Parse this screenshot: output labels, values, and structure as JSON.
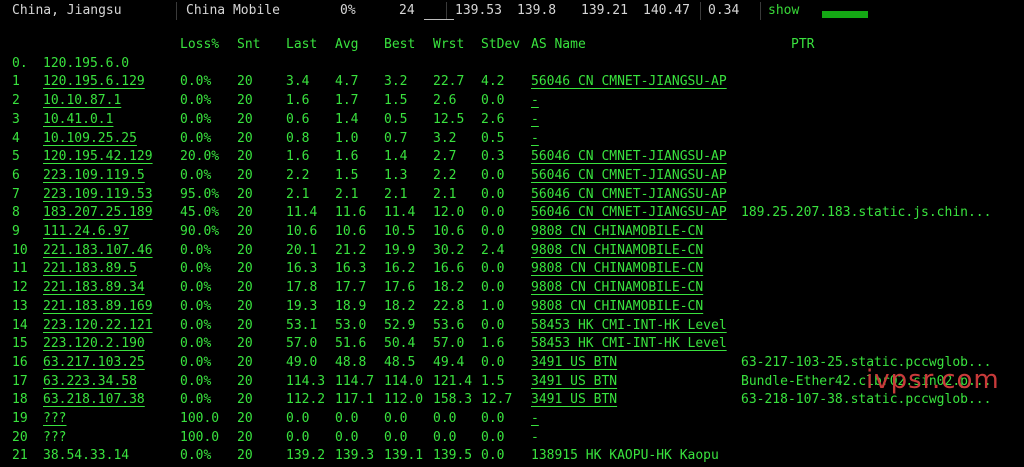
{
  "header": {
    "location": "China, Jiangsu",
    "isp": "China Mobile",
    "loss": "0%",
    "sent": "24",
    "last": "139.53",
    "avg": "139.8",
    "best": "139.21",
    "worst": "140.47",
    "stdev": "0.34",
    "show_label": "show"
  },
  "columns": {
    "loss": "Loss%",
    "snt": "Snt",
    "last": "Last",
    "avg": "Avg",
    "best": "Best",
    "wrst": "Wrst",
    "stdev": "StDev",
    "as": "AS Name",
    "ptr": "PTR"
  },
  "hops": [
    {
      "n": "0.",
      "ip": "120.195.6.0",
      "loss": "",
      "snt": "",
      "last": "",
      "avg": "",
      "best": "",
      "wrst": "",
      "stdev": "",
      "as": "",
      "ptr": "",
      "ul": false
    },
    {
      "n": "1",
      "ip": "120.195.6.129",
      "loss": "0.0%",
      "snt": "20",
      "last": "3.4",
      "avg": "4.7",
      "best": "3.2",
      "wrst": "22.7",
      "stdev": "4.2",
      "as": "56046 CN CMNET-JIANGSU-AP",
      "ptr": "",
      "ul": true
    },
    {
      "n": "2",
      "ip": "10.10.87.1",
      "loss": "0.0%",
      "snt": "20",
      "last": "1.6",
      "avg": "1.7",
      "best": "1.5",
      "wrst": "2.6",
      "stdev": "0.0",
      "as": "-",
      "ptr": "",
      "ul": true
    },
    {
      "n": "3",
      "ip": "10.41.0.1",
      "loss": "0.0%",
      "snt": "20",
      "last": "0.6",
      "avg": "1.4",
      "best": "0.5",
      "wrst": "12.5",
      "stdev": "2.6",
      "as": "-",
      "ptr": "",
      "ul": true
    },
    {
      "n": "4",
      "ip": "10.109.25.25",
      "loss": "0.0%",
      "snt": "20",
      "last": "0.8",
      "avg": "1.0",
      "best": "0.7",
      "wrst": "3.2",
      "stdev": "0.5",
      "as": "-",
      "ptr": "",
      "ul": true
    },
    {
      "n": "5",
      "ip": "120.195.42.129",
      "loss": "20.0%",
      "snt": "20",
      "last": "1.6",
      "avg": "1.6",
      "best": "1.4",
      "wrst": "2.7",
      "stdev": "0.3",
      "as": "56046 CN CMNET-JIANGSU-AP",
      "ptr": "",
      "ul": true
    },
    {
      "n": "6",
      "ip": "223.109.119.5",
      "loss": "0.0%",
      "snt": "20",
      "last": "2.2",
      "avg": "1.5",
      "best": "1.3",
      "wrst": "2.2",
      "stdev": "0.0",
      "as": "56046 CN CMNET-JIANGSU-AP",
      "ptr": "",
      "ul": true
    },
    {
      "n": "7",
      "ip": "223.109.119.53",
      "loss": "95.0%",
      "snt": "20",
      "last": "2.1",
      "avg": "2.1",
      "best": "2.1",
      "wrst": "2.1",
      "stdev": "0.0",
      "as": "56046 CN CMNET-JIANGSU-AP",
      "ptr": "",
      "ul": true
    },
    {
      "n": "8",
      "ip": "183.207.25.189",
      "loss": "45.0%",
      "snt": "20",
      "last": "11.4",
      "avg": "11.6",
      "best": "11.4",
      "wrst": "12.0",
      "stdev": "0.0",
      "as": "56046 CN CMNET-JIANGSU-AP",
      "ptr": "189.25.207.183.static.js.chin...",
      "ul": true
    },
    {
      "n": "9",
      "ip": "111.24.6.97",
      "loss": "90.0%",
      "snt": "20",
      "last": "10.6",
      "avg": "10.6",
      "best": "10.5",
      "wrst": "10.6",
      "stdev": "0.0",
      "as": "9808  CN CHINAMOBILE-CN",
      "ptr": "",
      "ul": true
    },
    {
      "n": "10",
      "ip": "221.183.107.46",
      "loss": "0.0%",
      "snt": "20",
      "last": "20.1",
      "avg": "21.2",
      "best": "19.9",
      "wrst": "30.2",
      "stdev": "2.4",
      "as": "9808  CN CHINAMOBILE-CN",
      "ptr": "",
      "ul": true
    },
    {
      "n": "11",
      "ip": "221.183.89.5",
      "loss": "0.0%",
      "snt": "20",
      "last": "16.3",
      "avg": "16.3",
      "best": "16.2",
      "wrst": "16.6",
      "stdev": "0.0",
      "as": "9808  CN CHINAMOBILE-CN",
      "ptr": "",
      "ul": true
    },
    {
      "n": "12",
      "ip": "221.183.89.34",
      "loss": "0.0%",
      "snt": "20",
      "last": "17.8",
      "avg": "17.7",
      "best": "17.6",
      "wrst": "18.2",
      "stdev": "0.0",
      "as": "9808  CN CHINAMOBILE-CN",
      "ptr": "",
      "ul": true
    },
    {
      "n": "13",
      "ip": "221.183.89.169",
      "loss": "0.0%",
      "snt": "20",
      "last": "19.3",
      "avg": "18.9",
      "best": "18.2",
      "wrst": "22.8",
      "stdev": "1.0",
      "as": "9808  CN CHINAMOBILE-CN",
      "ptr": "",
      "ul": true
    },
    {
      "n": "14",
      "ip": "223.120.22.121",
      "loss": "0.0%",
      "snt": "20",
      "last": "53.1",
      "avg": "53.0",
      "best": "52.9",
      "wrst": "53.6",
      "stdev": "0.0",
      "as": "58453 HK CMI-INT-HK Level",
      "ptr": "",
      "ul": true
    },
    {
      "n": "15",
      "ip": "223.120.2.190",
      "loss": "0.0%",
      "snt": "20",
      "last": "57.0",
      "avg": "51.6",
      "best": "50.4",
      "wrst": "57.0",
      "stdev": "1.6",
      "as": "58453 HK CMI-INT-HK Level",
      "ptr": "",
      "ul": true
    },
    {
      "n": "16",
      "ip": "63.217.103.25",
      "loss": "0.0%",
      "snt": "20",
      "last": "49.0",
      "avg": "48.8",
      "best": "48.5",
      "wrst": "49.4",
      "stdev": "0.0",
      "as": "3491  US BTN",
      "ptr": "63-217-103-25.static.pccwglob...",
      "ul": true
    },
    {
      "n": "17",
      "ip": "63.223.34.58",
      "loss": "0.0%",
      "snt": "20",
      "last": "114.3",
      "avg": "114.7",
      "best": "114.0",
      "wrst": "121.4",
      "stdev": "1.5",
      "as": "3491  US BTN",
      "ptr": "Bundle-Ether42.clbr02.sin02.p...",
      "ul": true
    },
    {
      "n": "18",
      "ip": "63.218.107.38",
      "loss": "0.0%",
      "snt": "20",
      "last": "112.2",
      "avg": "117.1",
      "best": "112.0",
      "wrst": "158.3",
      "stdev": "12.7",
      "as": "3491  US BTN",
      "ptr": "63-218-107-38.static.pccwglob...",
      "ul": true
    },
    {
      "n": "19",
      "ip": "???",
      "loss": "100.0",
      "snt": "20",
      "last": "0.0",
      "avg": "0.0",
      "best": "0.0",
      "wrst": "0.0",
      "stdev": "0.0",
      "as": "-",
      "ptr": "",
      "ul": true
    },
    {
      "n": "20",
      "ip": "???",
      "loss": "100.0",
      "snt": "20",
      "last": "0.0",
      "avg": "0.0",
      "best": "0.0",
      "wrst": "0.0",
      "stdev": "0.0",
      "as": "-",
      "ptr": "",
      "ul": false
    },
    {
      "n": "21",
      "ip": "38.54.33.14",
      "loss": "0.0%",
      "snt": "20",
      "last": "139.2",
      "avg": "139.3",
      "best": "139.1",
      "wrst": "139.5",
      "stdev": "0.0",
      "as": "138915 HK KAOPU-HK Kaopu",
      "ptr": "",
      "ul": false
    }
  ],
  "watermark": "ivpsr.com",
  "colors": {
    "text": "#39e23e",
    "header_text": "#d6d6d6",
    "background": "#000000",
    "watermark": "#c83a3a"
  }
}
